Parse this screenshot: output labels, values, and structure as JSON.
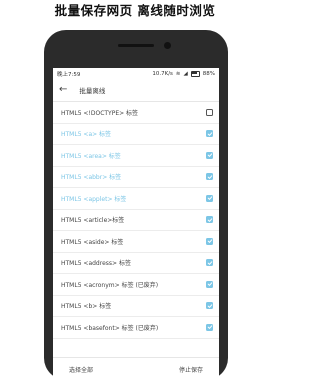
{
  "promo_title": "批量保存网页  离线随时浏览",
  "status": {
    "time": "晚上7:59",
    "speed": "10.7K/s",
    "battery": "88%"
  },
  "appbar": {
    "title": "批量离线"
  },
  "items": [
    {
      "label": "HTML5 <!DOCTYPE> 标签",
      "checked": false,
      "highlighted": false
    },
    {
      "label": "HTML5 <a> 标签",
      "checked": true,
      "highlighted": true
    },
    {
      "label": "HTML5 <area> 标签",
      "checked": true,
      "highlighted": true
    },
    {
      "label": "HTML5 <abbr> 标签",
      "checked": true,
      "highlighted": true
    },
    {
      "label": "HTML5 <applet> 标签",
      "checked": true,
      "highlighted": true
    },
    {
      "label": "HTML5 <article>标签",
      "checked": true,
      "highlighted": false
    },
    {
      "label": "HTML5 <aside> 标签",
      "checked": true,
      "highlighted": false
    },
    {
      "label": "HTML5 <address> 标签",
      "checked": true,
      "highlighted": false
    },
    {
      "label": "HTML5 <acronym> 标签 (已废弃)",
      "checked": true,
      "highlighted": false
    },
    {
      "label": "HTML5 <b> 标签",
      "checked": true,
      "highlighted": false
    },
    {
      "label": "HTML5 <basefont> 标签 (已废弃)",
      "checked": true,
      "highlighted": false
    }
  ],
  "footer": {
    "select_all": "选择全部",
    "stop_save": "停止保存"
  },
  "colors": {
    "accent": "#7cc6e6"
  }
}
